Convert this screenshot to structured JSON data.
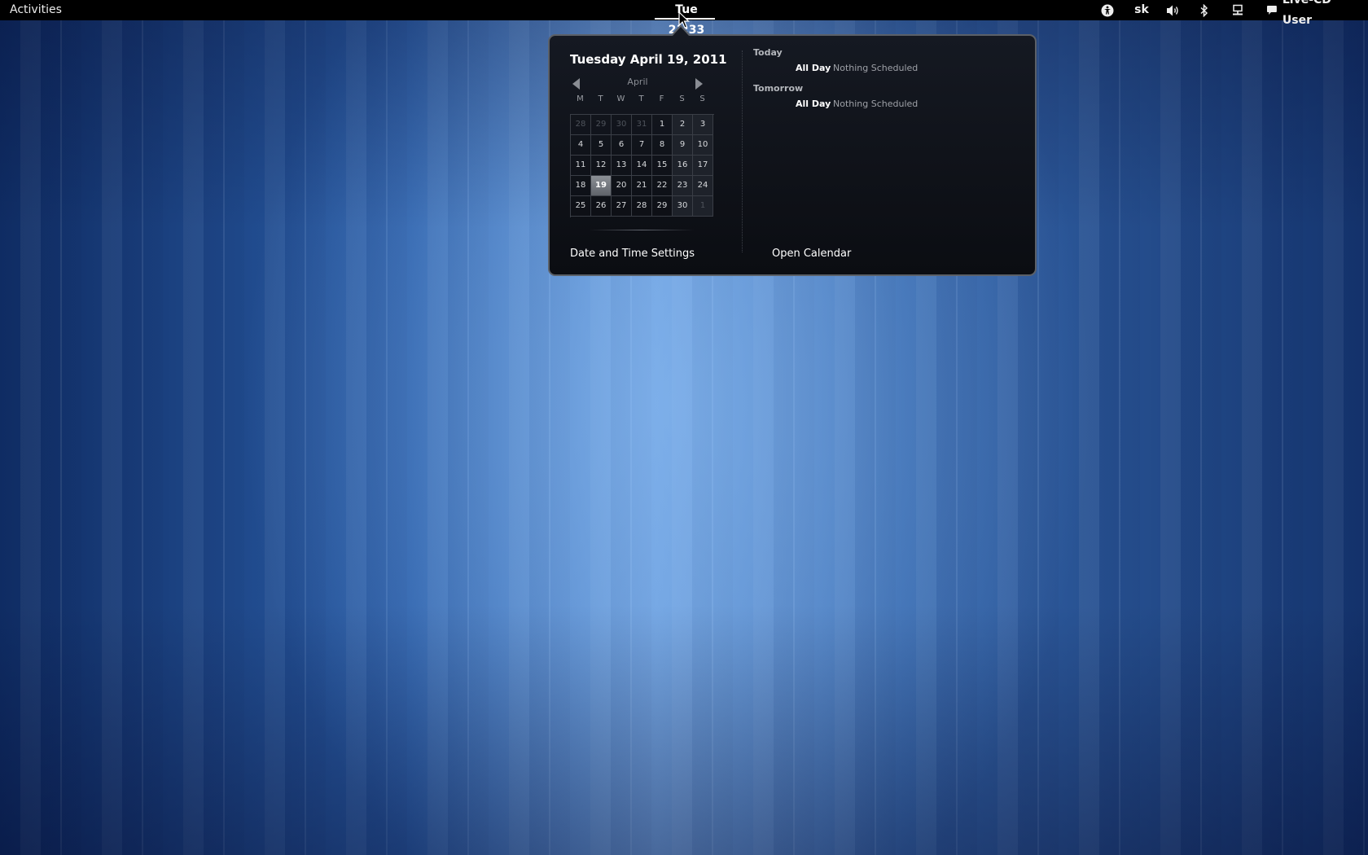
{
  "topbar": {
    "activities": "Activities",
    "clock": "Tue 21:33",
    "keyboard_layout": "sk",
    "user": "Live-CD User",
    "icons": [
      "accessibility-icon",
      "volume-icon",
      "bluetooth-icon",
      "network-icon",
      "chat-icon"
    ]
  },
  "calendar": {
    "date_heading": "Tuesday April 19, 2011",
    "month": "April",
    "weekdays": [
      "M",
      "T",
      "W",
      "T",
      "F",
      "S",
      "S"
    ],
    "weeks": [
      [
        "28",
        "29",
        "30",
        "31",
        "1",
        "2",
        "3"
      ],
      [
        "4",
        "5",
        "6",
        "7",
        "8",
        "9",
        "10"
      ],
      [
        "11",
        "12",
        "13",
        "14",
        "15",
        "16",
        "17"
      ],
      [
        "18",
        "19",
        "20",
        "21",
        "22",
        "23",
        "24"
      ],
      [
        "25",
        "26",
        "27",
        "28",
        "29",
        "30",
        "1"
      ]
    ],
    "today": "19",
    "date_time_settings": "Date and Time Settings"
  },
  "events": {
    "today_label": "Today",
    "today_time": "All Day",
    "today_desc": "Nothing Scheduled",
    "tomorrow_label": "Tomorrow",
    "tomorrow_time": "All Day",
    "tomorrow_desc": "Nothing Scheduled",
    "open_calendar": "Open Calendar"
  }
}
